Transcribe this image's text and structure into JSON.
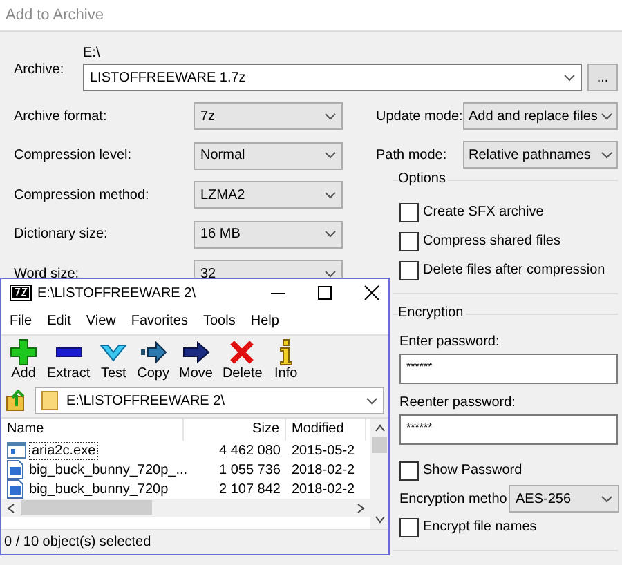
{
  "dialog": {
    "title": "Add to Archive",
    "archive": {
      "label": "Archive:",
      "folder": "E:\\",
      "value": "LISTOFFREEWARE 1.7z",
      "browse": "..."
    },
    "left_fields": [
      {
        "label": "Archive format:",
        "value": "7z"
      },
      {
        "label": "Compression level:",
        "value": "Normal"
      },
      {
        "label": "Compression method:",
        "value": "LZMA2"
      },
      {
        "label": "Dictionary size:",
        "value": "16 MB"
      },
      {
        "label": "Word size:",
        "value": "32"
      }
    ],
    "right_fields": [
      {
        "label": "Update mode:",
        "value": "Add and replace files"
      },
      {
        "label": "Path mode:",
        "value": "Relative pathnames"
      }
    ],
    "options": {
      "title": "Options",
      "items": [
        {
          "label": "Create SFX archive",
          "checked": false
        },
        {
          "label": "Compress shared files",
          "checked": false
        },
        {
          "label": "Delete files after compression",
          "checked": false
        }
      ]
    },
    "encryption": {
      "title": "Encryption",
      "password_label": "Enter password:",
      "password": "******",
      "reenter_label": "Reenter password:",
      "reenter": "******",
      "show_password": {
        "label": "Show Password",
        "checked": false
      },
      "method_label": "Encryption metho",
      "method": "AES-256",
      "encrypt_names": {
        "label": "Encrypt file names",
        "checked": false
      }
    }
  },
  "file_manager": {
    "title": "E:\\LISTOFFREEWARE 2\\",
    "menu": [
      "File",
      "Edit",
      "View",
      "Favorites",
      "Tools",
      "Help"
    ],
    "toolbar": [
      {
        "label": "Add",
        "kind": "add"
      },
      {
        "label": "Extract",
        "kind": "extract"
      },
      {
        "label": "Test",
        "kind": "test"
      },
      {
        "label": "Copy",
        "kind": "copy"
      },
      {
        "label": "Move",
        "kind": "move"
      },
      {
        "label": "Delete",
        "kind": "delete"
      },
      {
        "label": "Info",
        "kind": "info"
      }
    ],
    "address": "E:\\LISTOFFREEWARE 2\\",
    "columns": [
      "Name",
      "Size",
      "Modified"
    ],
    "rows": [
      {
        "name": "aria2c.exe",
        "size": "4 462 080",
        "modified": "2015-05-2",
        "kind": "exe",
        "focused": true
      },
      {
        "name": "big_buck_bunny_720p_...",
        "size": "1 055 736",
        "modified": "2018-02-2",
        "kind": "file",
        "focused": false
      },
      {
        "name": "big_buck_bunny_720p",
        "size": "2 107 842",
        "modified": "2018-02-2",
        "kind": "file",
        "focused": false
      }
    ],
    "status": "0 / 10 object(s) selected"
  }
}
